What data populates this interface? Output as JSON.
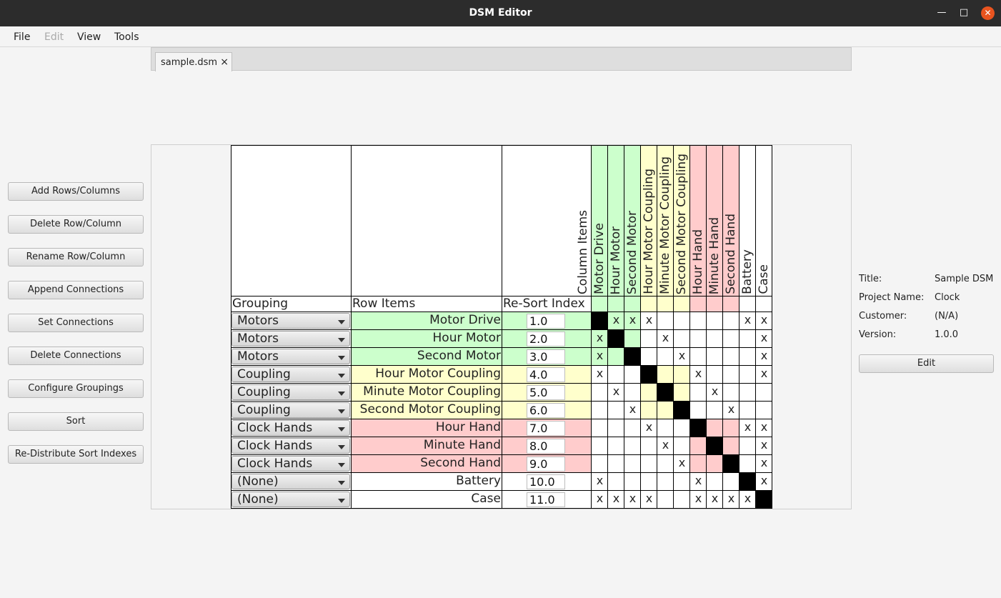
{
  "window": {
    "title": "DSM Editor"
  },
  "menu": [
    {
      "label": "File",
      "enabled": true
    },
    {
      "label": "Edit",
      "enabled": false
    },
    {
      "label": "View",
      "enabled": true
    },
    {
      "label": "Tools",
      "enabled": true
    }
  ],
  "sidebar": {
    "buttons": [
      "Add Rows/Columns",
      "Delete Row/Column",
      "Rename Row/Column",
      "Append Connections",
      "Set Connections",
      "Delete Connections",
      "Configure Groupings",
      "Sort",
      "Re-Distribute Sort Indexes"
    ]
  },
  "tab": {
    "label": "sample.dsm",
    "close": "×"
  },
  "matrix": {
    "column_items_label": "Column Items",
    "headers": {
      "grouping": "Grouping",
      "row_items": "Row Items",
      "resort": "Re-Sort Index"
    },
    "group_colors": {
      "Motors": "#ccffcc",
      "Coupling": "#ffffcc",
      "Clock Hands": "#ffcccc",
      "(None)": "#ffffff"
    },
    "columns": [
      {
        "name": "Motor Drive",
        "group": "Motors"
      },
      {
        "name": "Hour Motor",
        "group": "Motors"
      },
      {
        "name": "Second Motor",
        "group": "Motors"
      },
      {
        "name": "Hour Motor Coupling",
        "group": "Coupling"
      },
      {
        "name": "Minute Motor Coupling",
        "group": "Coupling"
      },
      {
        "name": "Second Motor Coupling",
        "group": "Coupling"
      },
      {
        "name": "Hour Hand",
        "group": "Clock Hands"
      },
      {
        "name": "Minute Hand",
        "group": "Clock Hands"
      },
      {
        "name": "Second Hand",
        "group": "Clock Hands"
      },
      {
        "name": "Battery",
        "group": "(None)"
      },
      {
        "name": "Case",
        "group": "(None)"
      }
    ],
    "rows": [
      {
        "group": "Motors",
        "name": "Motor Drive",
        "sort": "1.0",
        "connections": [
          1,
          2,
          3,
          9,
          10
        ]
      },
      {
        "group": "Motors",
        "name": "Hour Motor",
        "sort": "2.0",
        "connections": [
          0,
          4,
          10
        ]
      },
      {
        "group": "Motors",
        "name": "Second Motor",
        "sort": "3.0",
        "connections": [
          0,
          5,
          10
        ]
      },
      {
        "group": "Coupling",
        "name": "Hour Motor Coupling",
        "sort": "4.0",
        "connections": [
          0,
          6,
          10
        ]
      },
      {
        "group": "Coupling",
        "name": "Minute Motor Coupling",
        "sort": "5.0",
        "connections": [
          1,
          7
        ]
      },
      {
        "group": "Coupling",
        "name": "Second Motor Coupling",
        "sort": "6.0",
        "connections": [
          2,
          8
        ]
      },
      {
        "group": "Clock Hands",
        "name": "Hour Hand",
        "sort": "7.0",
        "connections": [
          3,
          9,
          10
        ]
      },
      {
        "group": "Clock Hands",
        "name": "Minute Hand",
        "sort": "8.0",
        "connections": [
          4,
          10
        ]
      },
      {
        "group": "Clock Hands",
        "name": "Second Hand",
        "sort": "9.0",
        "connections": [
          5,
          10
        ]
      },
      {
        "group": "(None)",
        "name": "Battery",
        "sort": "10.0",
        "connections": [
          0,
          6,
          10
        ]
      },
      {
        "group": "(None)",
        "name": "Case",
        "sort": "11.0",
        "connections": [
          0,
          1,
          2,
          3,
          6,
          7,
          8,
          9
        ]
      }
    ],
    "connection_mark": "x"
  },
  "info": {
    "title_label": "Title:",
    "title_value": "Sample DSM",
    "project_label": "Project Name:",
    "project_value": "Clock",
    "customer_label": "Customer:",
    "customer_value": "(N/A)",
    "version_label": "Version:",
    "version_value": "1.0.0",
    "edit_label": "Edit"
  }
}
